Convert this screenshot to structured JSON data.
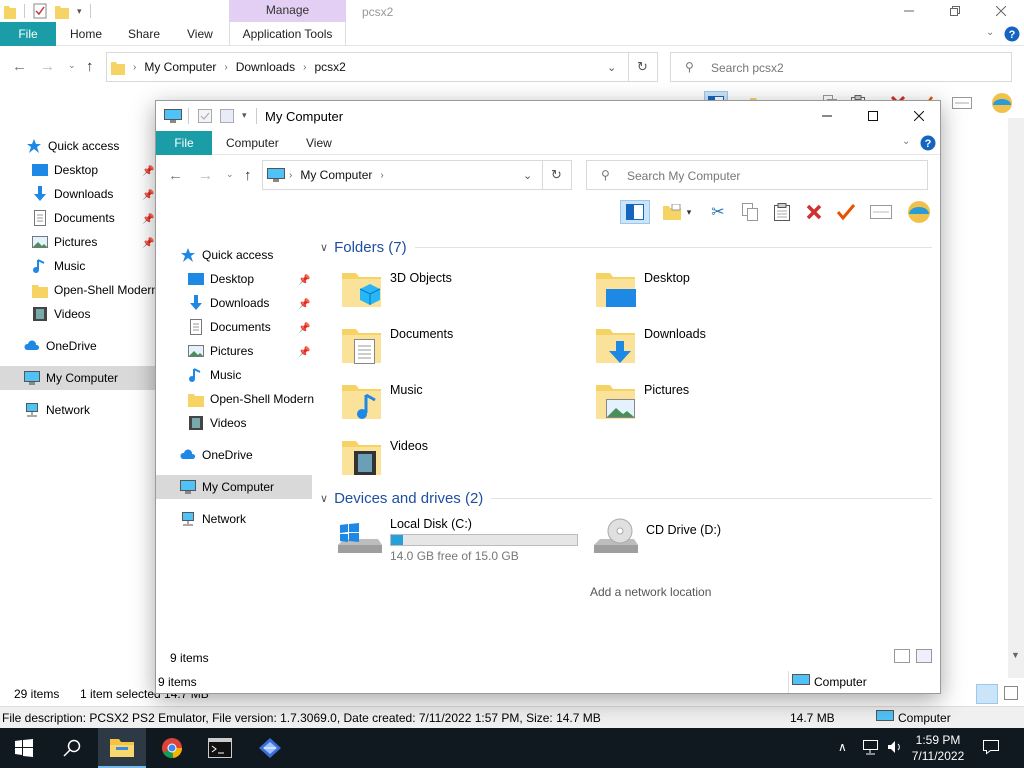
{
  "back_window": {
    "contextual_tab_group": "Manage",
    "title": "pcsx2",
    "tabs": {
      "file": "File",
      "home": "Home",
      "share": "Share",
      "view": "View",
      "application_tools": "Application Tools"
    },
    "address": {
      "root": "My Computer",
      "crumbs": [
        "My Computer",
        "Downloads",
        "pcsx2"
      ]
    },
    "search_placeholder": "Search pcsx2",
    "nav": {
      "quick_access": "Quick access",
      "items": [
        "Desktop",
        "Downloads",
        "Documents",
        "Pictures",
        "Music",
        "Open-Shell Modern",
        "Videos"
      ],
      "onedrive": "OneDrive",
      "my_computer": "My Computer",
      "network": "Network"
    },
    "status": {
      "items": "29 items",
      "selected": "1 item selected  14.7 MB"
    },
    "description": "File description: PCSX2 PS2 Emulator, File version: 1.7.3069.0, Date created: 7/11/2022 1:57 PM, Size: 14.7 MB",
    "desc_size": "14.7 MB",
    "desc_location": "Computer"
  },
  "front_window": {
    "title": "My Computer",
    "tabs": {
      "file": "File",
      "computer": "Computer",
      "view": "View"
    },
    "address": {
      "crumbs": [
        "My Computer"
      ]
    },
    "search_placeholder": "Search My Computer",
    "nav": {
      "quick_access": "Quick access",
      "items": [
        "Desktop",
        "Downloads",
        "Documents",
        "Pictures",
        "Music",
        "Open-Shell Modern",
        "Videos"
      ],
      "onedrive": "OneDrive",
      "my_computer": "My Computer",
      "network": "Network"
    },
    "folders_header": "Folders (7)",
    "folders": [
      "3D Objects",
      "Desktop",
      "Documents",
      "Downloads",
      "Music",
      "Pictures",
      "Videos"
    ],
    "drives_header": "Devices and drives (2)",
    "drives": [
      {
        "name": "Local Disk (C:)",
        "free": "14.0 GB free of 15.0 GB",
        "used_fraction": 0.067
      },
      {
        "name": "CD Drive (D:)"
      }
    ],
    "add_network_location": "Add a network location",
    "status_items": "9 items",
    "bottom_items": "9 items",
    "bottom_location": "Computer"
  },
  "taskbar": {
    "time": "1:59 PM",
    "date": "7/11/2022"
  },
  "colors": {
    "file_tab": "#1a9da6",
    "manage_tab": "#e3cff3",
    "accent": "#1e4fa3",
    "taskbar": "#101820",
    "selection": "#d9d9d9"
  }
}
